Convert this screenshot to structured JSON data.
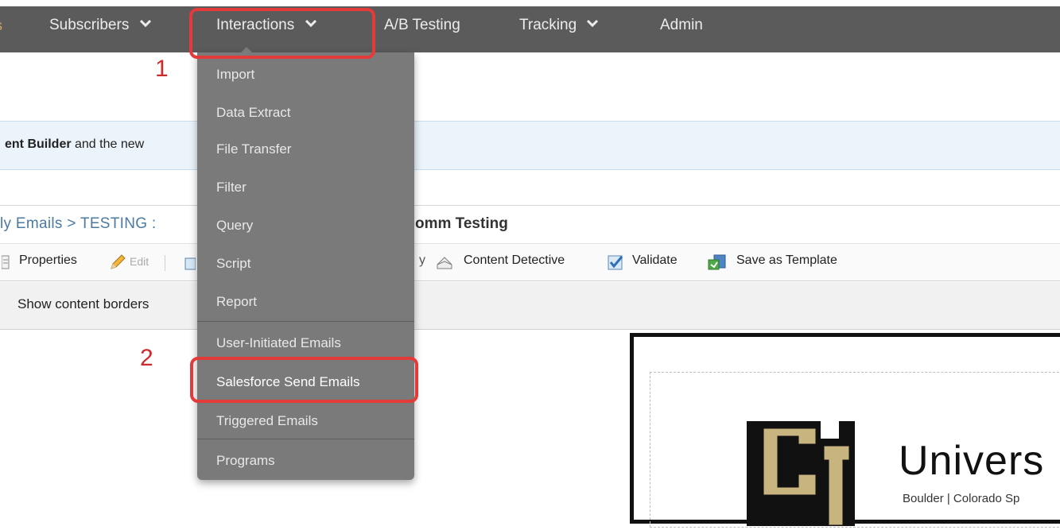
{
  "nav": {
    "edge_glyph": "s",
    "items": [
      {
        "label": "Subscribers",
        "dropdown": true
      },
      {
        "label": "Interactions",
        "dropdown": true
      },
      {
        "label": "A/B Testing",
        "dropdown": false
      },
      {
        "label": "Tracking",
        "dropdown": true
      },
      {
        "label": "Admin",
        "dropdown": false
      }
    ]
  },
  "annotations": {
    "step1": "1",
    "step2": "2",
    "highlight_color": "#e33a3a"
  },
  "banner": {
    "bold": "ent Builder",
    "rest": " and the new"
  },
  "breadcrumb": {
    "path": "ly Emails > TESTING :",
    "title": "omm Testing"
  },
  "toolbar": {
    "properties": "Properties",
    "edit": "Edit",
    "separator_text": "y",
    "content_detective": "Content Detective",
    "validate": "Validate",
    "save_as_template": "Save as Template"
  },
  "options": {
    "show_content_borders": "Show content borders"
  },
  "interactions_menu": {
    "items": [
      "Import",
      "Data Extract",
      "File Transfer",
      "Filter",
      "Query",
      "Script",
      "Report",
      "User-Initiated Emails",
      "Salesforce Send Emails",
      "Triggered Emails",
      "Programs"
    ],
    "selected": "Salesforce Send Emails"
  },
  "preview": {
    "logo_text": "Univers",
    "subline": "Boulder | Colorado Sp"
  },
  "colors": {
    "nav_bg": "#5b5b5b",
    "menu_bg": "#7a7a7a",
    "banner_bg": "#ebf4fb",
    "link_blue": "#4b7aa3",
    "cu_gold": "#c8b47e"
  }
}
